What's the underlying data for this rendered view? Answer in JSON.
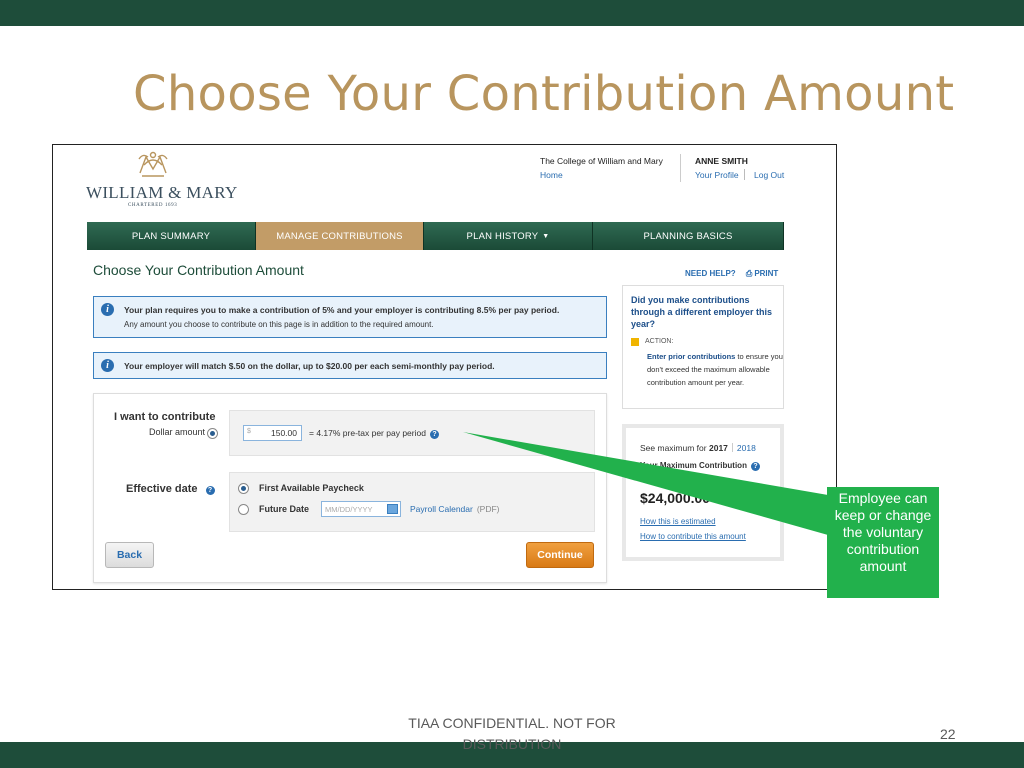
{
  "slide": {
    "title": "Choose Your Contribution Amount",
    "footer": "TIAA CONFIDENTIAL. NOT FOR DISTRIBUTION",
    "page_number": "22",
    "colors": {
      "bar": "#1e4d3a",
      "title": "#b8955e",
      "callout": "#22b14c"
    }
  },
  "logo": {
    "name": "WILLIAM & MARY",
    "subtitle": "CHARTERED 1693"
  },
  "header": {
    "college": "The College of William and Mary",
    "home": "Home",
    "user": "ANNE SMITH",
    "profile": "Your Profile",
    "logout": "Log Out"
  },
  "nav": {
    "tabs": [
      {
        "label": "PLAN SUMMARY",
        "active": false
      },
      {
        "label": "MANAGE CONTRIBUTIONS",
        "active": true
      },
      {
        "label": "PLAN HISTORY",
        "active": false,
        "caret": "▼"
      },
      {
        "label": "PLANNING BASICS",
        "active": false
      }
    ]
  },
  "page": {
    "heading": "Choose Your Contribution Amount",
    "need_help": "NEED HELP?",
    "print": "PRINT",
    "print_icon": "printer-icon"
  },
  "info": {
    "requirement_bold": "Your plan requires you to make a contribution of 5% and your employer is contributing 8.5% per pay period.",
    "requirement_note": "Any amount you choose to contribute on this page is in addition to the required amount.",
    "match": "Your employer will match $.50 on the dollar, up to $20.00 per each semi-monthly pay period.",
    "icon": "i"
  },
  "form": {
    "want_label": "I want to contribute",
    "dollar_label": "Dollar amount",
    "currency": "$",
    "amount": "150.00",
    "pretax_text": "= 4.17% pre-tax per pay period",
    "help_icon": "?",
    "effective_label": "Effective date",
    "option_first": "First Available Paycheck",
    "option_future": "Future Date",
    "date_placeholder": "MM/DD/YYYY",
    "calendar_link": "Payroll Calendar",
    "calendar_pdf": "(PDF)",
    "back_label": "Back",
    "continue_label": "Continue"
  },
  "sidebar": {
    "prior_title": "Did you make contributions through a different employer this year?",
    "action_label": "ACTION:",
    "action_link": "Enter prior contributions",
    "action_text": " to ensure you don't exceed the maximum allowable contribution amount per year.",
    "see_max": "See maximum for",
    "year_current": "2017",
    "year_next": "2018",
    "max_label": "Your Maximum Contribution",
    "max_amount": "$24,000.00",
    "link_estimated": "How this is estimated",
    "link_how": "How to contribute this amount"
  },
  "callout": {
    "text": "Employee can keep or change the voluntary contribution amount"
  }
}
